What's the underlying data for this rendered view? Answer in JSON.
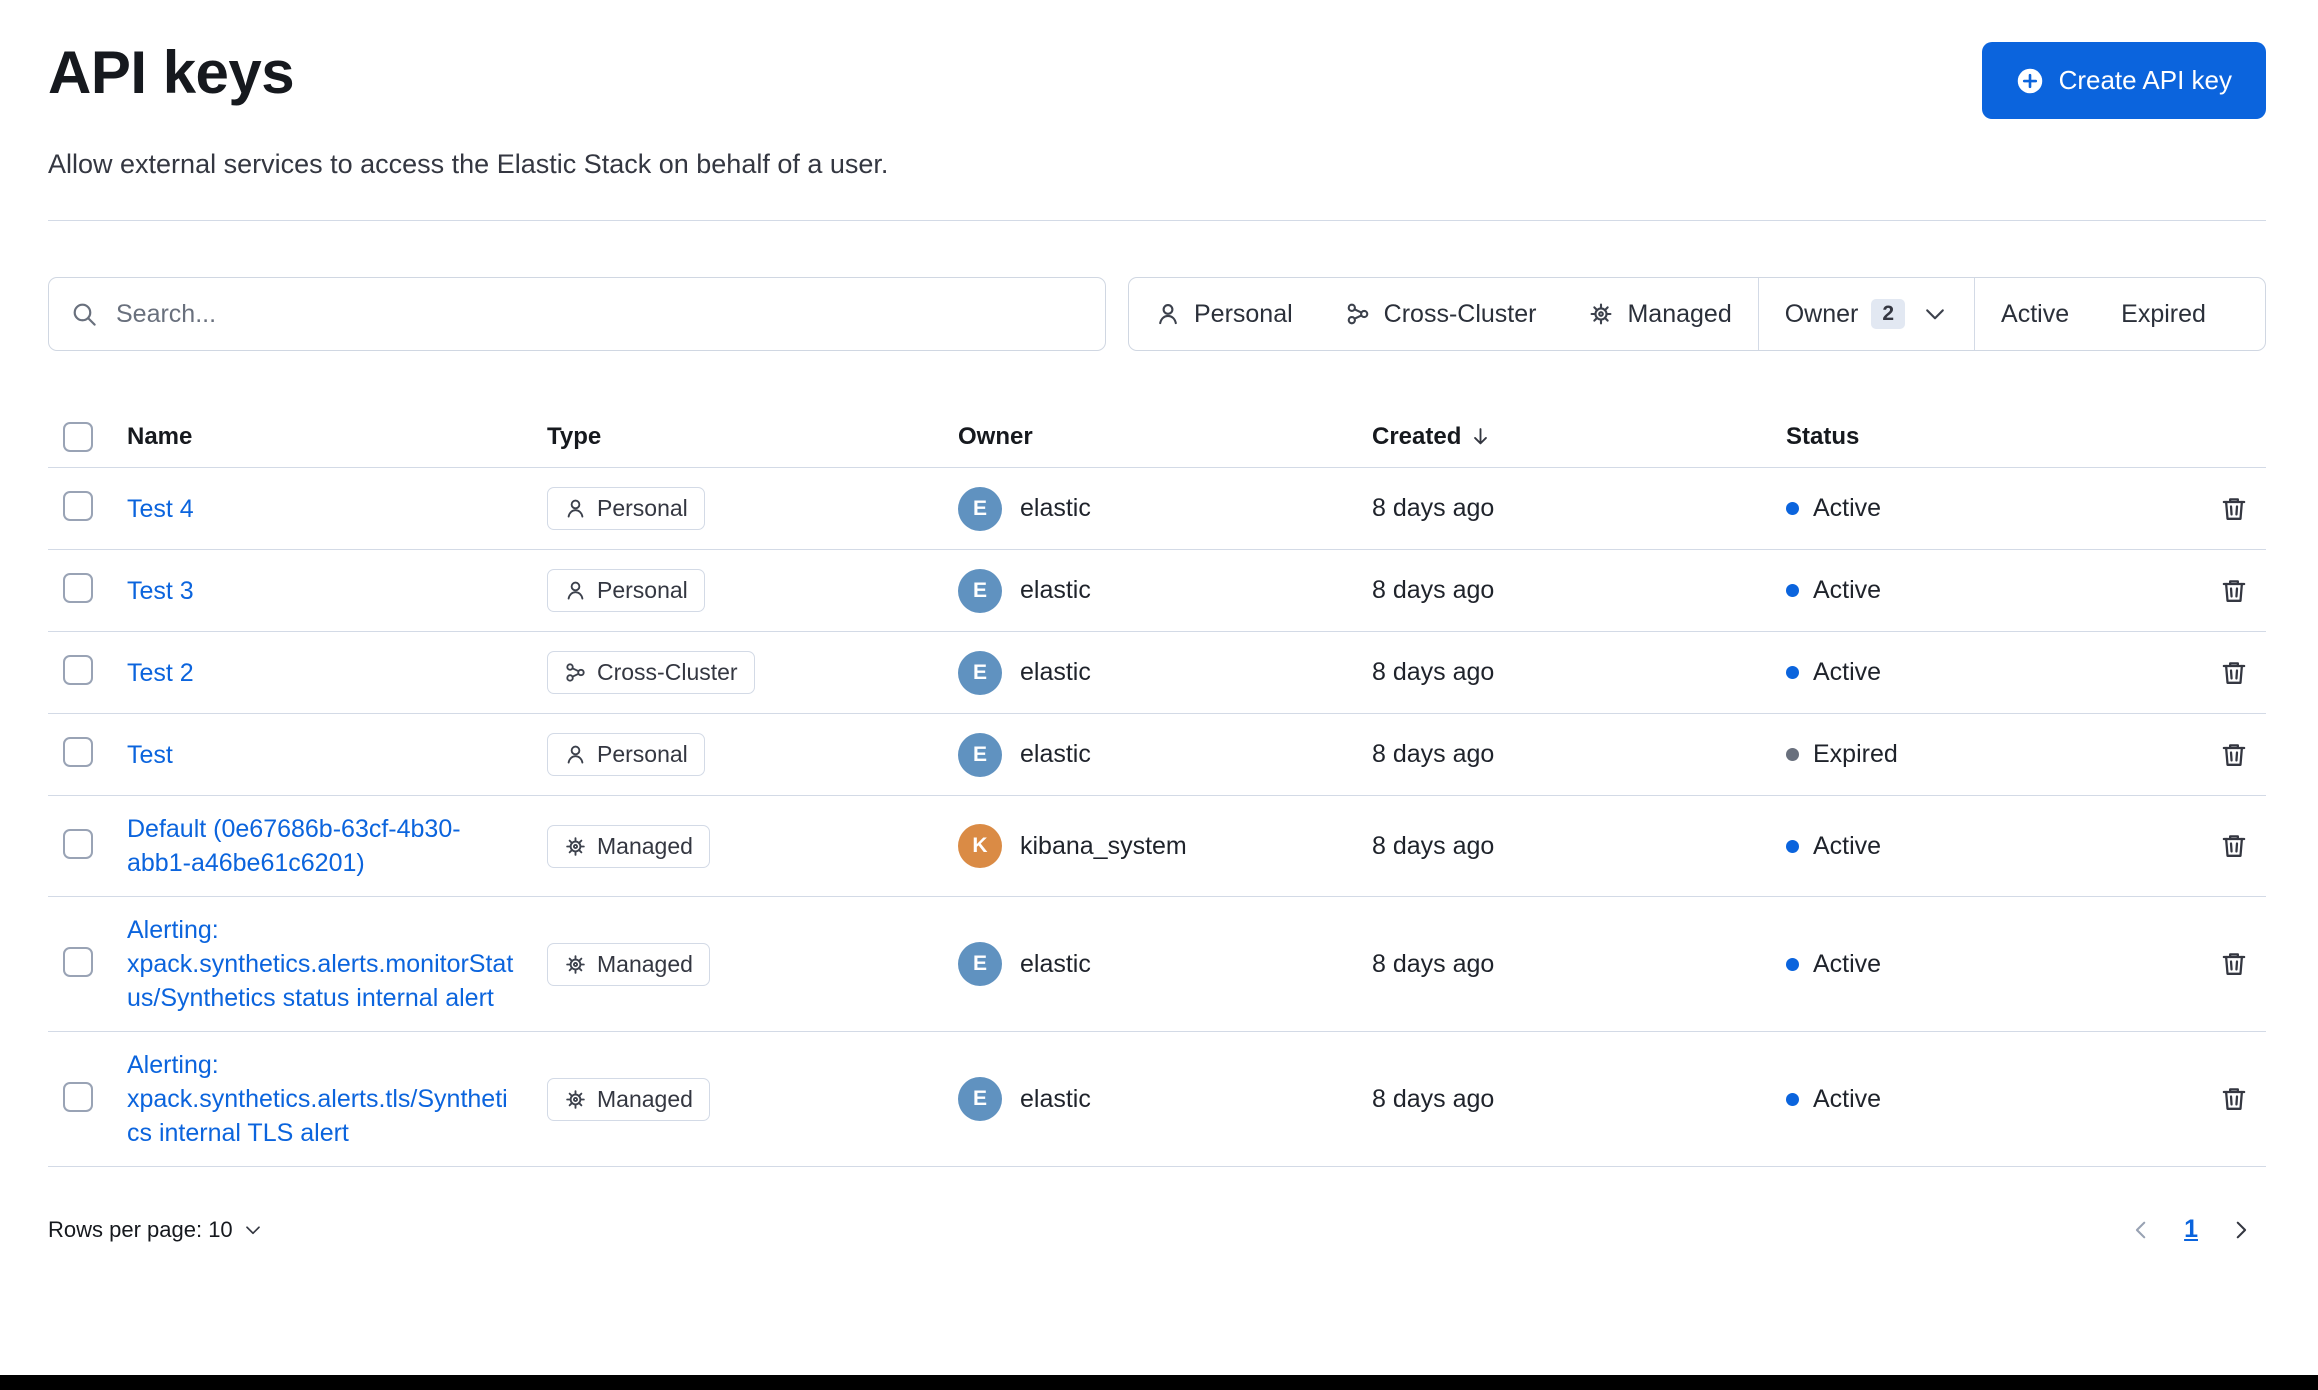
{
  "colors": {
    "primary": "#0b64dd",
    "link": "#0b64dd",
    "status_active": "#0b64dd",
    "status_expired": "#69707d",
    "avatar_elastic": "#6092c0",
    "avatar_kibana_system": "#da8b45"
  },
  "page": {
    "title": "API keys",
    "subtitle": "Allow external services to access the Elastic Stack on behalf of a user.",
    "create_button_label": "Create API key"
  },
  "search": {
    "placeholder": "Search..."
  },
  "filters": {
    "personal_label": "Personal",
    "cross_cluster_label": "Cross-Cluster",
    "managed_label": "Managed",
    "owner_label": "Owner",
    "owner_count": "2",
    "active_label": "Active",
    "expired_label": "Expired"
  },
  "table": {
    "headers": {
      "name": "Name",
      "type": "Type",
      "owner": "Owner",
      "created": "Created",
      "status": "Status"
    },
    "rows": [
      {
        "name": "Test 4",
        "type": "Personal",
        "owner": "elastic",
        "owner_initial": "E",
        "avatar_color": "#6092c0",
        "created": "8 days ago",
        "status": "Active",
        "status_color": "#0b64dd"
      },
      {
        "name": "Test 3",
        "type": "Personal",
        "owner": "elastic",
        "owner_initial": "E",
        "avatar_color": "#6092c0",
        "created": "8 days ago",
        "status": "Active",
        "status_color": "#0b64dd"
      },
      {
        "name": "Test 2",
        "type": "Cross-Cluster",
        "owner": "elastic",
        "owner_initial": "E",
        "avatar_color": "#6092c0",
        "created": "8 days ago",
        "status": "Active",
        "status_color": "#0b64dd"
      },
      {
        "name": "Test",
        "type": "Personal",
        "owner": "elastic",
        "owner_initial": "E",
        "avatar_color": "#6092c0",
        "created": "8 days ago",
        "status": "Expired",
        "status_color": "#69707d"
      },
      {
        "name": "Default (0e67686b-63cf-4b30-abb1-a46be61c6201)",
        "type": "Managed",
        "owner": "kibana_system",
        "owner_initial": "K",
        "avatar_color": "#da8b45",
        "created": "8 days ago",
        "status": "Active",
        "status_color": "#0b64dd"
      },
      {
        "name": "Alerting: xpack.synthetics.alerts.monitorStatus/Synthetics status internal alert",
        "type": "Managed",
        "owner": "elastic",
        "owner_initial": "E",
        "avatar_color": "#6092c0",
        "created": "8 days ago",
        "status": "Active",
        "status_color": "#0b64dd"
      },
      {
        "name": "Alerting: xpack.synthetics.alerts.tls/Synthetics internal TLS alert",
        "type": "Managed",
        "owner": "elastic",
        "owner_initial": "E",
        "avatar_color": "#6092c0",
        "created": "8 days ago",
        "status": "Active",
        "status_color": "#0b64dd"
      }
    ]
  },
  "footer": {
    "rows_per_page_label": "Rows per page: 10",
    "current_page": "1"
  }
}
